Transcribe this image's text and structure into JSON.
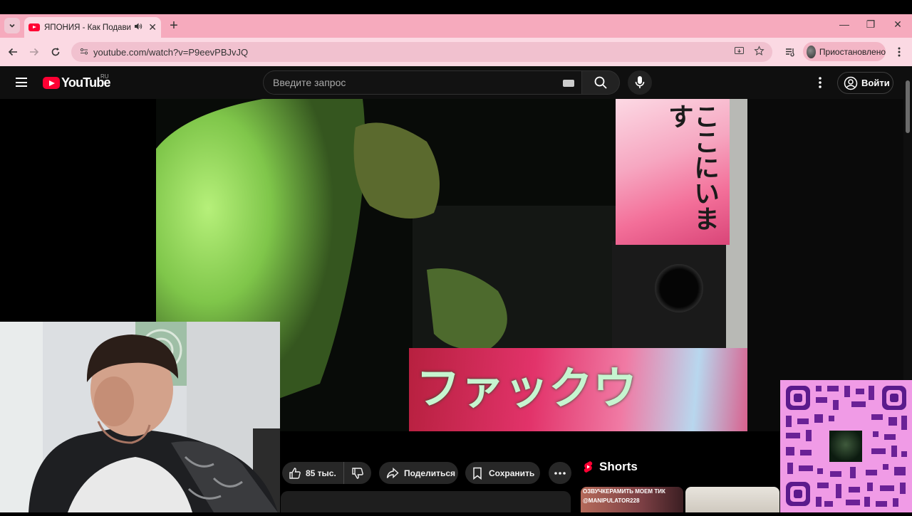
{
  "browser": {
    "tab": {
      "title": "ЯПОНИЯ - Как Подавить Н",
      "audio_icon": "speaker-icon",
      "close_glyph": "✕"
    },
    "new_tab_glyph": "+",
    "window_controls": [
      "—",
      "❐",
      "✕"
    ],
    "address": {
      "url": "youtube.com/watch?v=P9eevPBJvJQ"
    },
    "profile": {
      "status": "Приостановлено"
    },
    "theme_color": "#f6aabd"
  },
  "youtube": {
    "logo_text": "YouTube",
    "region": "RU",
    "search": {
      "placeholder": "Введите запрос"
    },
    "sign_in_label": "Войти",
    "accent_color": "#ff0033"
  },
  "video": {
    "overlay_text_top": "ここにいます",
    "overlay_text_bottom": "ファックウ"
  },
  "actions": {
    "like_count": "85 тыс.",
    "share_label": "Поделиться",
    "save_label": "Сохранить"
  },
  "shorts": {
    "heading": "Shorts",
    "thumb1_caption_line1": "ОЗВУЧКЕРАМИТЬ МОЕМ ТИК",
    "thumb1_caption_line2": "@MANIPULATOR228"
  }
}
